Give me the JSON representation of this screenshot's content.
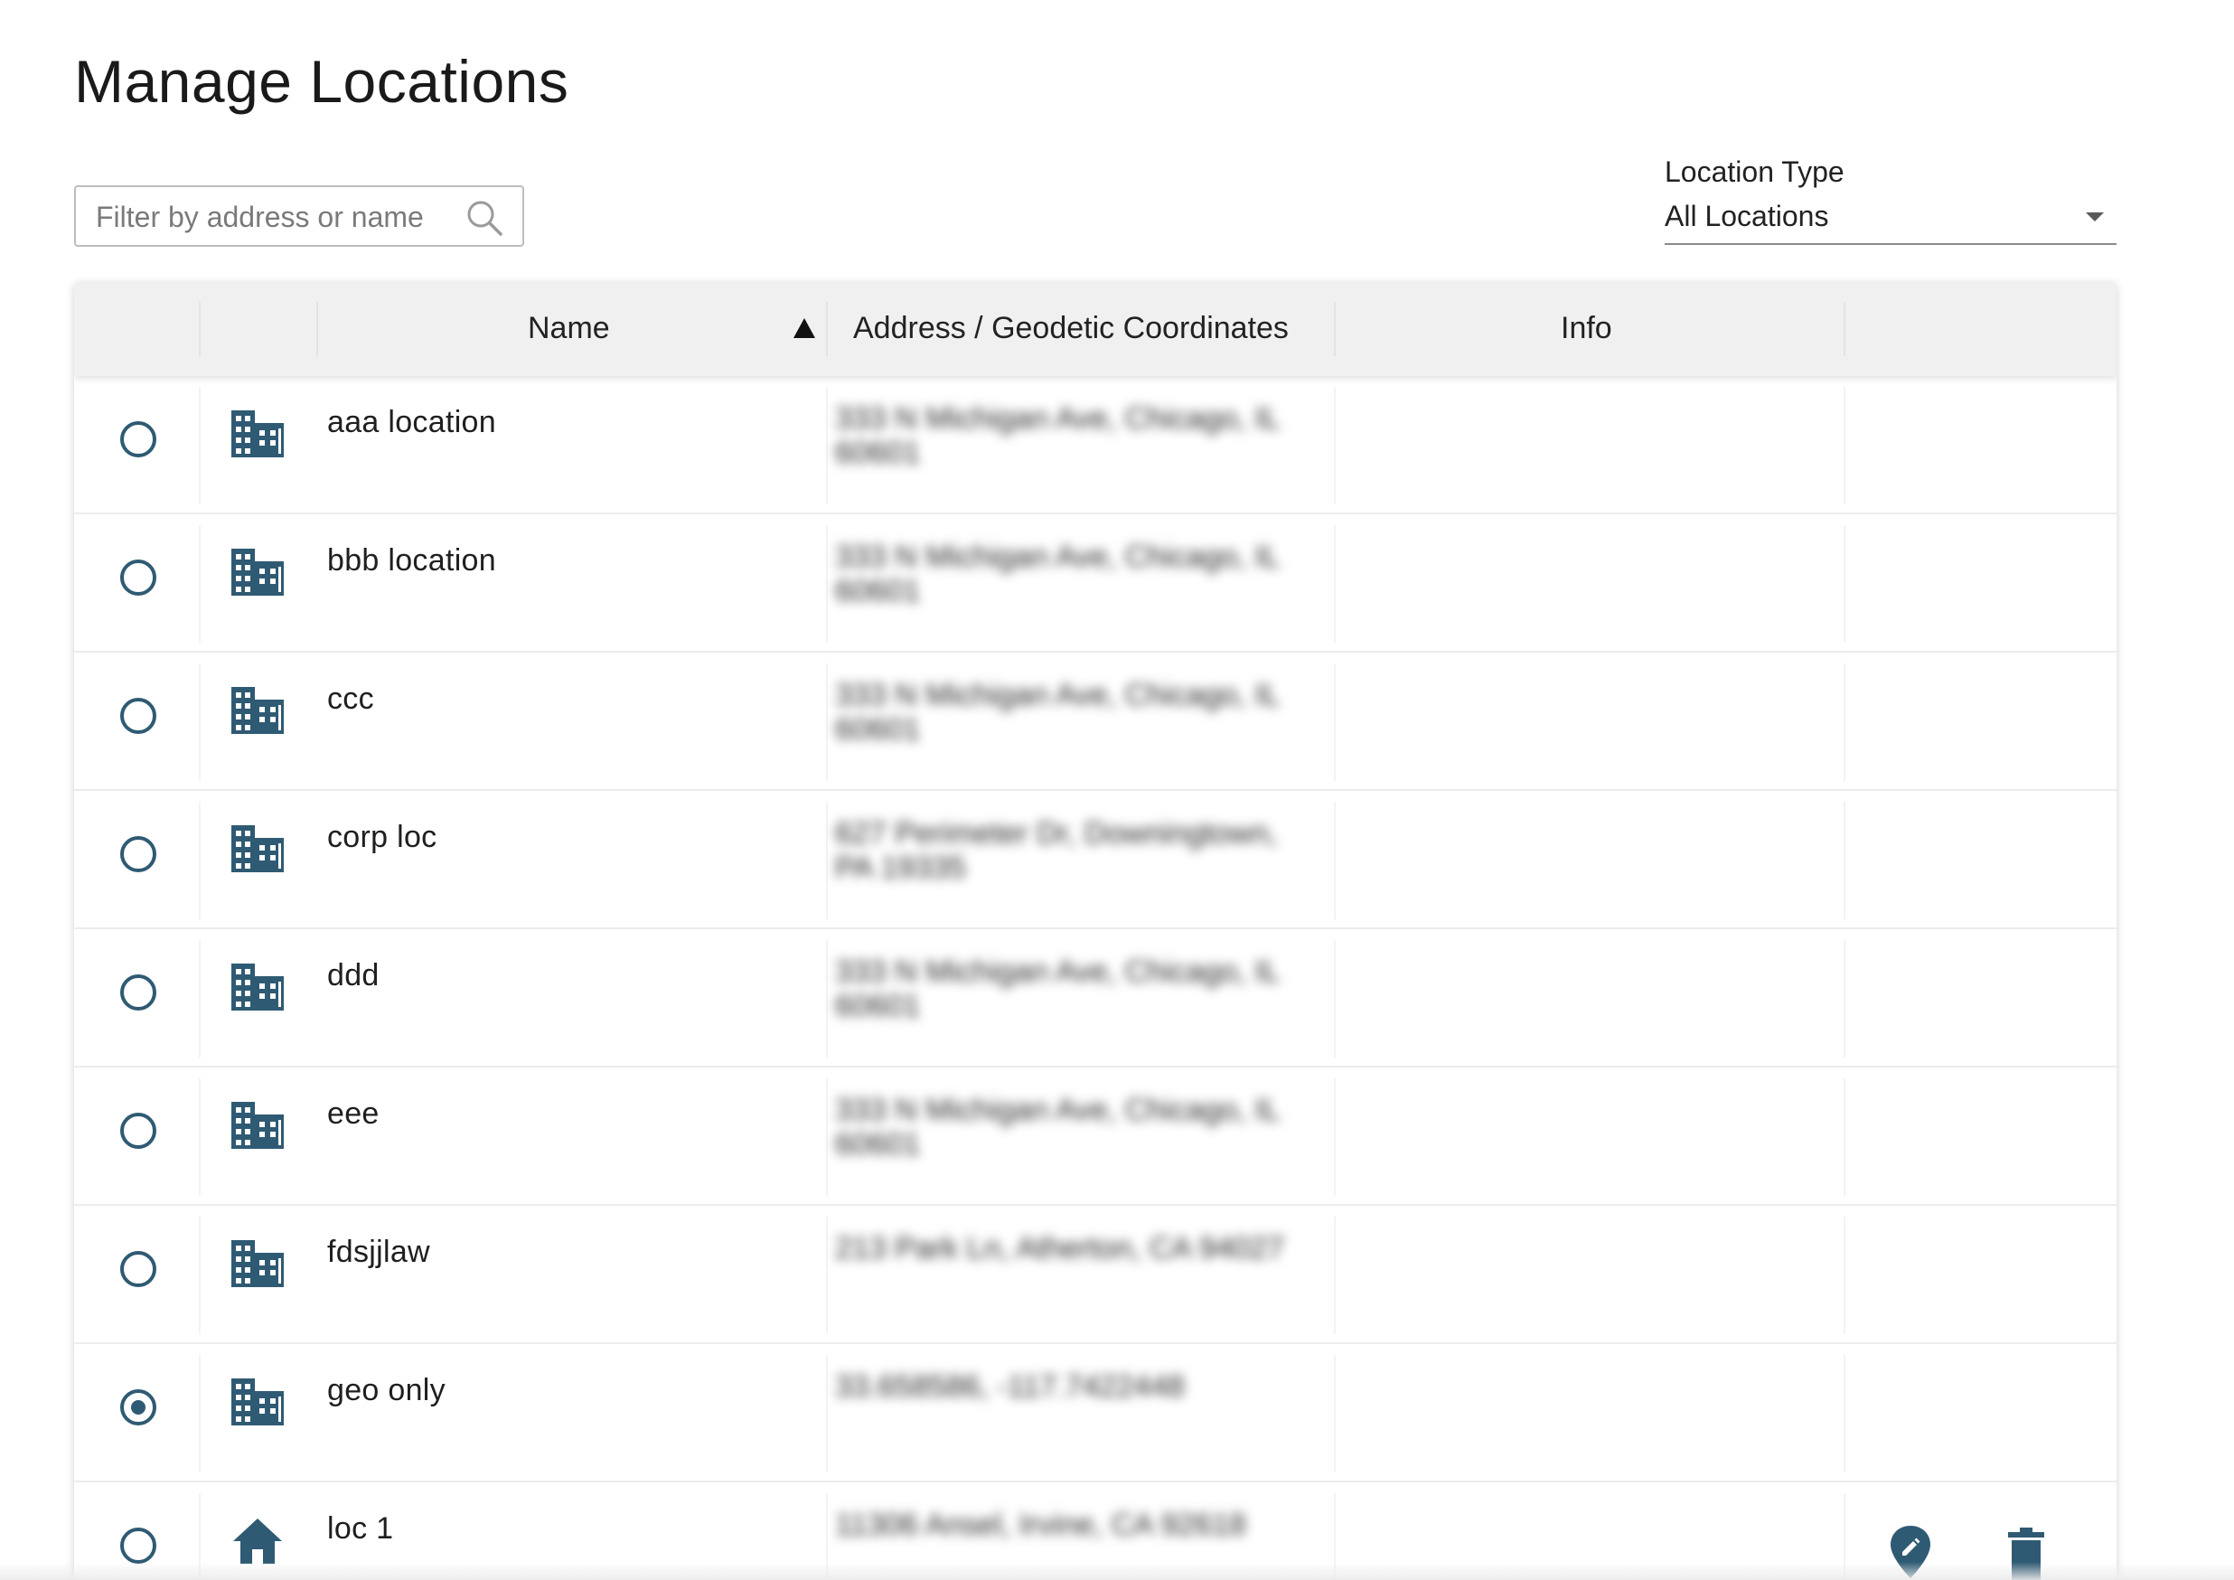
{
  "page": {
    "title": "Manage Locations"
  },
  "filter": {
    "placeholder": "Filter by address or name",
    "value": ""
  },
  "location_type": {
    "label": "Location Type",
    "value": "All Locations"
  },
  "table": {
    "columns": {
      "name": "Name",
      "address": "Address / Geodetic Coordinates",
      "info": "Info"
    },
    "sort": {
      "column": "Name",
      "direction": "ascending"
    },
    "rows": [
      {
        "name": "aaa location",
        "address": "333 N Michigan Ave, Chicago, IL 60601",
        "type_icon": "building-icon",
        "selected": false
      },
      {
        "name": "bbb location",
        "address": "333 N Michigan Ave, Chicago, IL 60601",
        "type_icon": "building-icon",
        "selected": false
      },
      {
        "name": "ccc",
        "address": "333 N Michigan Ave, Chicago, IL 60601",
        "type_icon": "building-icon",
        "selected": false
      },
      {
        "name": "corp loc",
        "address": "627 Perimeter Dr, Downingtown, PA 19335",
        "type_icon": "building-icon",
        "selected": false
      },
      {
        "name": "ddd",
        "address": "333 N Michigan Ave, Chicago, IL 60601",
        "type_icon": "building-icon",
        "selected": false
      },
      {
        "name": "eee",
        "address": "333 N Michigan Ave, Chicago, IL 60601",
        "type_icon": "building-icon",
        "selected": false
      },
      {
        "name": "fdsjjlaw",
        "address": "213 Park Ln, Atherton, CA 94027",
        "type_icon": "building-icon",
        "selected": false
      },
      {
        "name": "geo only",
        "address": "33.658586, -117.7422448",
        "type_icon": "building-icon",
        "selected": true
      },
      {
        "name": "loc 1",
        "address": "11306 Ansel, Irvine, CA 92618",
        "type_icon": "home-icon",
        "selected": false,
        "actions": [
          "edit-location-icon",
          "delete-icon"
        ]
      }
    ]
  },
  "colors": {
    "accent": "#2f5a73",
    "header_bg": "#f0f0f0",
    "text": "#1f1f1f"
  }
}
